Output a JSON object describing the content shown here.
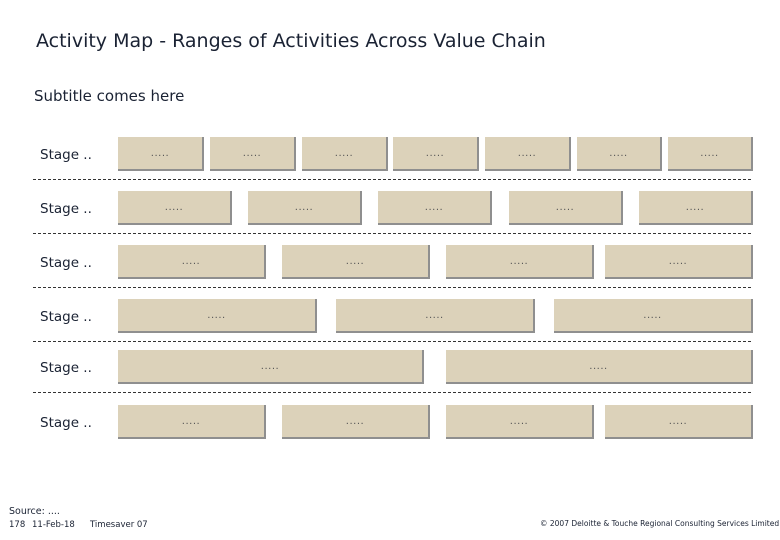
{
  "header": {
    "title": "Activity Map - Ranges of Activities Across Value Chain",
    "subtitle": "Subtitle comes here"
  },
  "stages": [
    {
      "label": "Stage ..",
      "activities": [
        ".....",
        ".....",
        ".....",
        ".....",
        ".....",
        ".....",
        "....."
      ]
    },
    {
      "label": "Stage ..",
      "activities": [
        ".....",
        ".....",
        ".....",
        ".....",
        "....."
      ]
    },
    {
      "label": "Stage ..",
      "activities": [
        ".....",
        ".....",
        ".....",
        "....."
      ]
    },
    {
      "label": "Stage ..",
      "activities": [
        ".....",
        ".....",
        "....."
      ]
    },
    {
      "label": "Stage ..",
      "activities": [
        ".....",
        "....."
      ]
    },
    {
      "label": "Stage ..",
      "activities": [
        ".....",
        ".....",
        ".....",
        "....."
      ]
    }
  ],
  "colors": {
    "box_fill": "#dcd2ba",
    "box_shadow": "#8f8f8f",
    "text": "#1a2233"
  },
  "footer": {
    "source": "Source: ....",
    "page_number": "178",
    "date": "11-Feb-18",
    "doc_name": "Timesaver 07",
    "copyright": "© 2007 Deloitte & Touche Regional Consulting Services Limited"
  }
}
